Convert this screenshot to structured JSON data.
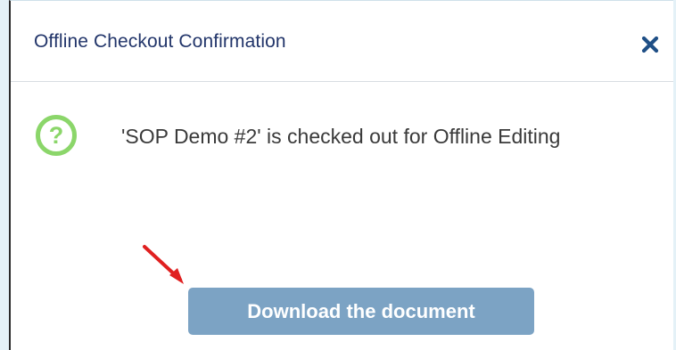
{
  "dialog": {
    "title": "Offline Checkout Confirmation",
    "close_icon": "close-icon",
    "message_icon": "question-circle-icon",
    "message": "'SOP Demo #2' is checked out for Offline Editing",
    "download_label": "Download the document"
  },
  "colors": {
    "title": "#22356a",
    "close": "#1f4f86",
    "question_icon": "#8bd66a",
    "button_bg": "#7ca3c4",
    "annotation_arrow": "#e02020"
  }
}
